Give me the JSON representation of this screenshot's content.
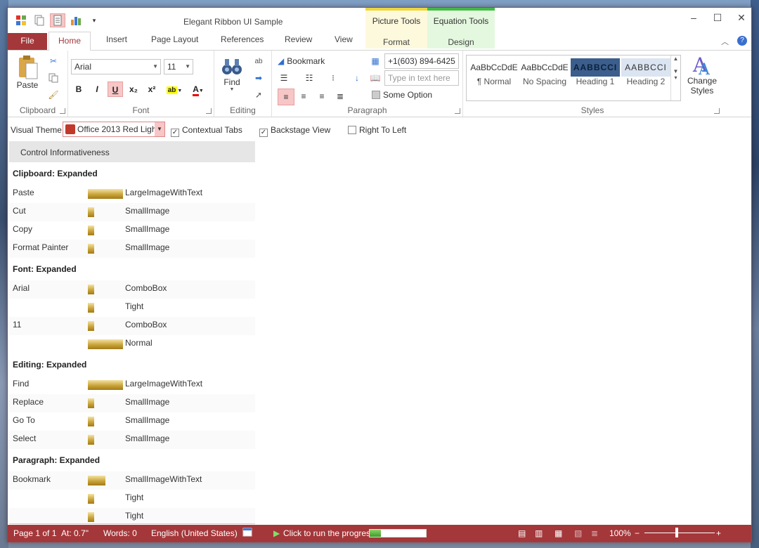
{
  "window": {
    "title": "Elegant Ribbon UI Sample"
  },
  "context_groups": {
    "picture": {
      "title": "Picture Tools",
      "tab": "Format"
    },
    "equation": {
      "title": "Equation Tools",
      "tab": "Design"
    }
  },
  "tabs": [
    "File",
    "Home",
    "Insert",
    "Page Layout",
    "References",
    "Review",
    "View"
  ],
  "ribbon": {
    "clipboard": {
      "label": "Clipboard",
      "paste": "Paste"
    },
    "font": {
      "label": "Font",
      "family": "Arial",
      "size": "11"
    },
    "editing": {
      "label": "Editing",
      "find": "Find"
    },
    "paragraph": {
      "label": "Paragraph",
      "bookmark": "Bookmark",
      "phone": "+1(603) 894-6425",
      "text_placeholder": "Type in text here",
      "some_option": "Some Option"
    },
    "styles": {
      "label": "Styles",
      "items": [
        {
          "preview": "AaBbCcDdE",
          "name": "¶ Normal"
        },
        {
          "preview": "AaBbCcDdE",
          "name": "No Spacing"
        },
        {
          "preview": "AABBCCI",
          "name": "Heading 1"
        },
        {
          "preview": "AABBCCI",
          "name": "Heading 2"
        }
      ],
      "change_styles": "Change Styles"
    }
  },
  "options": {
    "visual_theme_label": "Visual Theme",
    "visual_theme_value": "Office 2013 Red Ligh",
    "contextual_tabs": "Contextual Tabs",
    "backstage_view": "Backstage View",
    "right_to_left": "Right To Left"
  },
  "panel": {
    "header": "Control Informativeness",
    "sections": [
      {
        "title": "Clipboard: Expanded",
        "rows": [
          {
            "name": "Paste",
            "size": "large",
            "value": "LargeImageWithText"
          },
          {
            "name": "Cut",
            "size": "small",
            "value": "SmallImage"
          },
          {
            "name": "Copy",
            "size": "small",
            "value": "SmallImage"
          },
          {
            "name": "Format Painter",
            "size": "small",
            "value": "SmallImage"
          }
        ]
      },
      {
        "title": "Font: Expanded",
        "rows": [
          {
            "name": "Arial",
            "size": "small",
            "value": "ComboBox"
          },
          {
            "name": "",
            "size": "small",
            "value": "Tight"
          },
          {
            "name": "11",
            "size": "small",
            "value": "ComboBox"
          },
          {
            "name": "",
            "size": "large",
            "value": "Normal"
          }
        ]
      },
      {
        "title": "Editing: Expanded",
        "rows": [
          {
            "name": "Find",
            "size": "large",
            "value": "LargeImageWithText"
          },
          {
            "name": "Replace",
            "size": "small",
            "value": "SmallImage"
          },
          {
            "name": "Go To",
            "size": "small",
            "value": "SmallImage"
          },
          {
            "name": "Select",
            "size": "small",
            "value": "SmallImage"
          }
        ]
      },
      {
        "title": "Paragraph: Expanded",
        "rows": [
          {
            "name": "Bookmark",
            "size": "medium",
            "value": "SmallImageWithText"
          },
          {
            "name": "",
            "size": "small",
            "value": "Tight"
          },
          {
            "name": "",
            "size": "small",
            "value": "Tight"
          }
        ]
      }
    ]
  },
  "status": {
    "page": "Page 1 of 1",
    "at": "At: 0.7\"",
    "words": "Words: 0",
    "language": "English (United States)",
    "run_progress": "Click to run the progress",
    "progress": 0.2,
    "zoom": "100%"
  },
  "colors": {
    "accent": "#a4373a",
    "highlight": "#f7c6c6"
  }
}
